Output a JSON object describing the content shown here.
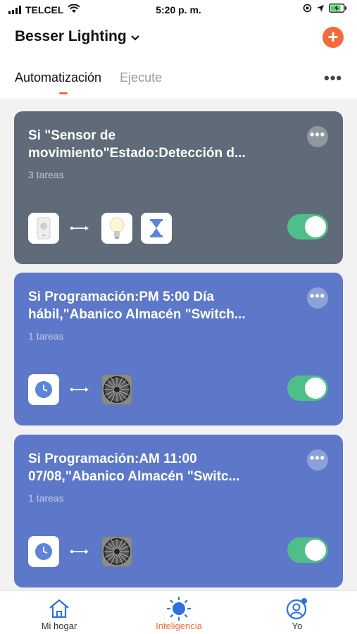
{
  "status_bar": {
    "carrier": "TELCEL",
    "time": "5:20 p. m."
  },
  "header": {
    "home_name": "Besser Lighting"
  },
  "tabs": [
    {
      "label": "Automatización",
      "active": true
    },
    {
      "label": "Ejecute",
      "active": false
    }
  ],
  "cards": [
    {
      "title_line1": "Si \"Sensor de",
      "title_line2": "movimiento\"Estado:Detección d...",
      "tasks": "3 tareas",
      "enabled": true
    },
    {
      "title_line1": "Si Programación:PM 5:00 Día",
      "title_line2": "hábil,\"Abanico Almacén \"Switch...",
      "tasks": "1 tareas",
      "enabled": true
    },
    {
      "title_line1": "Si Programación:AM 11:00",
      "title_line2": "07/08,\"Abanico Almacén \"Switc...",
      "tasks": "1 tareas",
      "enabled": true
    }
  ],
  "bottom_nav": [
    {
      "label": "Mi hogar",
      "active": false
    },
    {
      "label": "Inteligencia",
      "active": true
    },
    {
      "label": "Yo",
      "active": false
    }
  ],
  "colors": {
    "accent": "#f26a3d",
    "card_dark": "#5f6b78",
    "card_blue": "#5d78c8",
    "toggle_on": "#4fbf8a",
    "nav_icon_blue": "#2f6fe0"
  }
}
